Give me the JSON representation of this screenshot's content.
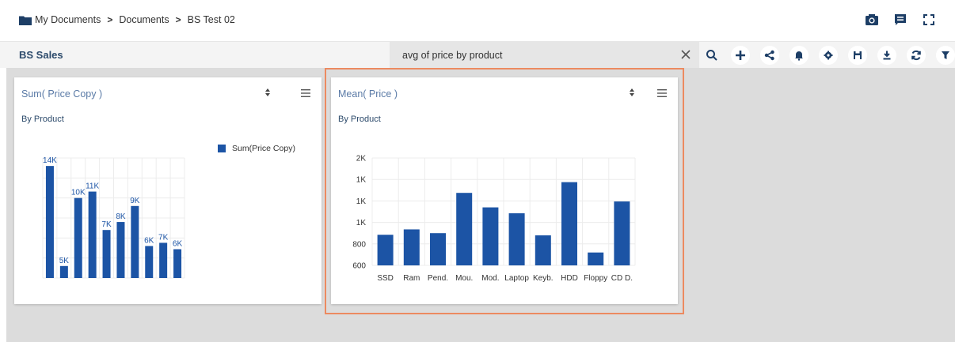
{
  "breadcrumb": {
    "items": [
      "My Documents",
      "Documents",
      "BS Test 02"
    ],
    "separator": ">"
  },
  "top_icons": [
    "camera-icon",
    "comment-icon",
    "fullscreen-icon"
  ],
  "toolbar": {
    "dashboard_title": "BS Sales",
    "search_value": "avg of price by product",
    "icons": [
      "search-icon",
      "plus-icon",
      "share-icon",
      "bell-icon",
      "gear-icon",
      "save-icon",
      "export-icon",
      "refresh-icon",
      "filter-icon"
    ],
    "accent_color": "#1c5aa6"
  },
  "cards": [
    {
      "title": "Sum( Price Copy )",
      "subtitle": "By Product"
    },
    {
      "title": "Mean( Price )",
      "subtitle": "By Product"
    }
  ],
  "chart_data": [
    {
      "type": "bar",
      "title": "Sum( Price Copy )",
      "subtitle": "By Product",
      "legend": {
        "label": "Sum(Price Copy)",
        "position": "top-right"
      },
      "data_labels": [
        "14K",
        "5K",
        "10K",
        "11K",
        "7K",
        "8K",
        "9K",
        "6K",
        "7K",
        "6K"
      ],
      "values": [
        14000,
        1500,
        10000,
        10800,
        6000,
        7000,
        9000,
        4000,
        4400,
        3600
      ],
      "color": "#1c54a5",
      "grid": true
    },
    {
      "type": "bar",
      "title": "Mean( Price )",
      "subtitle": "By Product",
      "categories": [
        "SSD",
        "Ram",
        "Pend.",
        "Mou.",
        "Mod.",
        "Laptop",
        "Keyb.",
        "HDD",
        "Floppy",
        "CD D."
      ],
      "values": [
        885,
        935,
        900,
        1275,
        1140,
        1085,
        880,
        1375,
        720,
        1195
      ],
      "y_tick_labels": [
        "2K",
        "1K",
        "1K",
        "1K",
        "800",
        "600"
      ],
      "ylim": [
        600,
        1600
      ],
      "color": "#1c54a5",
      "grid": true
    }
  ],
  "colors": {
    "highlight_border": "#ec8a60",
    "title_color": "#5a7aa6"
  }
}
